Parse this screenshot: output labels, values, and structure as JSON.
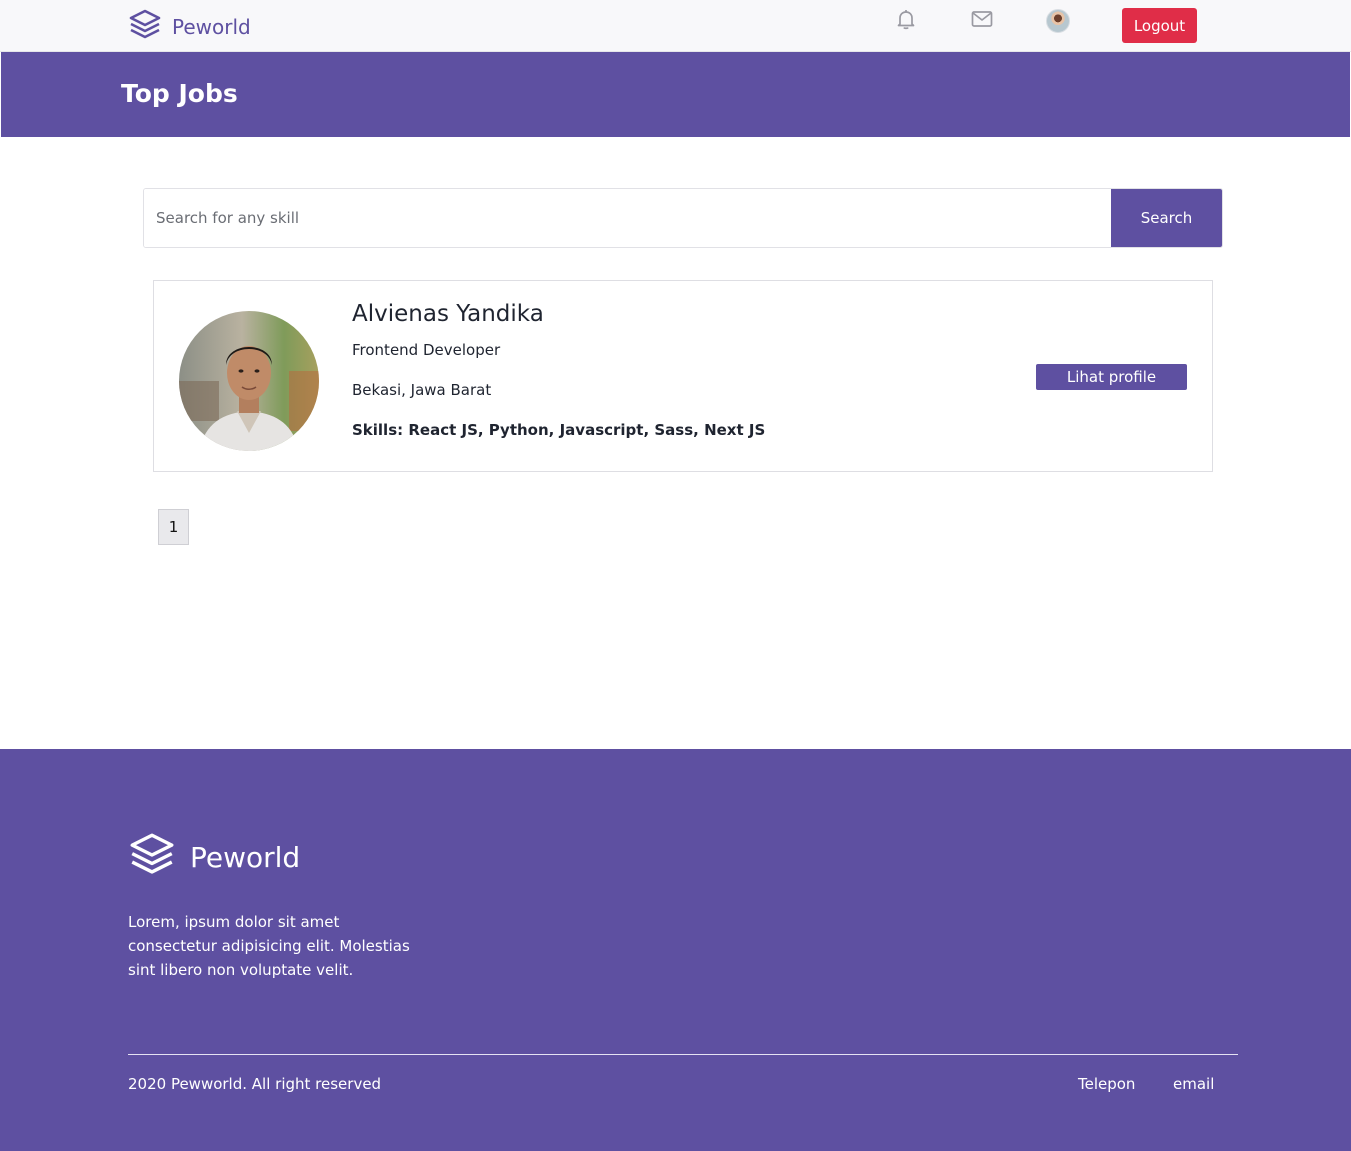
{
  "navbar": {
    "brand": "Peworld",
    "icons": [
      "layers-logo-icon",
      "bell-icon",
      "mail-icon",
      "user-avatar"
    ],
    "logout_label": "Logout"
  },
  "header": {
    "title": "Top Jobs"
  },
  "search": {
    "placeholder": "Search for any skill",
    "value": "",
    "button_label": "Search"
  },
  "results": [
    {
      "name": "Alvienas Yandika",
      "role": "Frontend Developer",
      "location": "Bekasi, Jawa Barat",
      "skills": "Skills: React JS, Python, Javascript, Sass, Next JS",
      "button_label": "Lihat profile"
    }
  ],
  "pagination": {
    "pages": [
      "1"
    ]
  },
  "footer": {
    "brand": "Peworld",
    "description": "Lorem, ipsum dolor sit amet consectetur adipisicing elit. Molestias sint libero non voluptate velit.",
    "copyright": "2020 Pewworld. All right reserved",
    "links": [
      "Telepon",
      "email"
    ]
  },
  "colors": {
    "primary": "#5e50a1",
    "danger": "#e02d48",
    "navbar_bg": "#f8f8fa"
  }
}
